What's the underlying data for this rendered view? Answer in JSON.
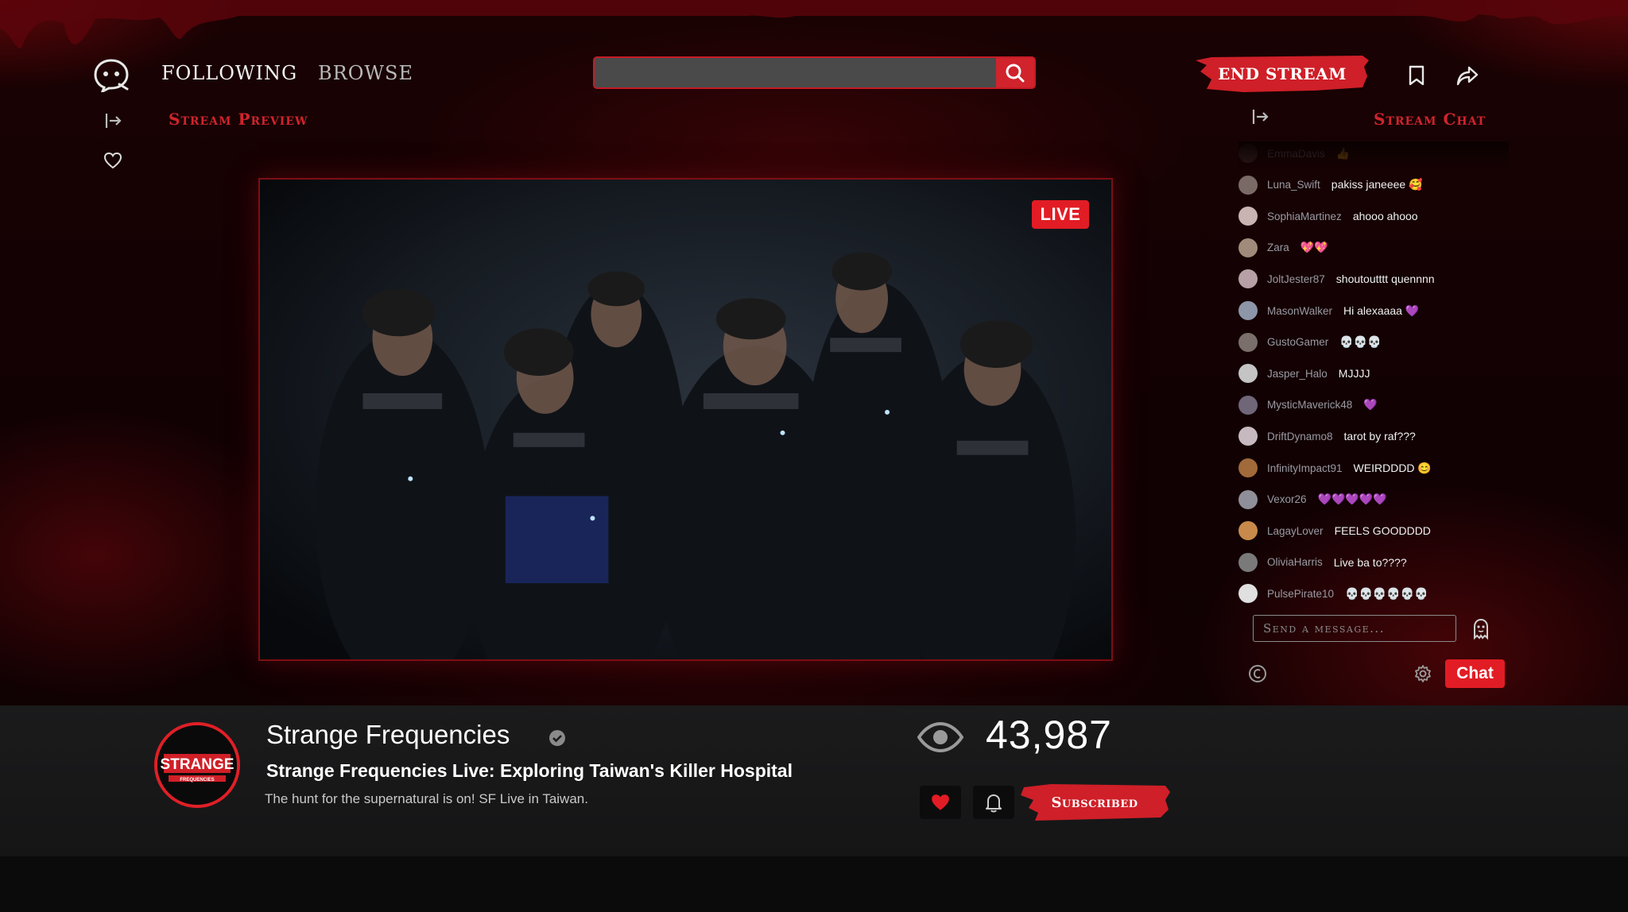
{
  "nav": {
    "following": "FOLLOWING",
    "browse": "BROWSE",
    "search_placeholder": "",
    "end_stream": "END STREAM"
  },
  "preview": {
    "title": "Stream Preview",
    "live_badge": "LIVE"
  },
  "chat": {
    "title": "Stream Chat",
    "messages": [
      {
        "user": "EmmaDavis",
        "text": "👍",
        "avatar_color": "#5a4a44"
      },
      {
        "user": "Luna_Swift",
        "text": "pakiss janeeee 🥰",
        "avatar_color": "#7a6a66"
      },
      {
        "user": "SophiaMartinez",
        "text": "ahooo ahooo",
        "avatar_color": "#c9b4b2"
      },
      {
        "user": "Zara",
        "text": "💖💖",
        "avatar_color": "#a08a7a"
      },
      {
        "user": "JoltJester87",
        "text": "shoutoutttt quennnn",
        "avatar_color": "#b7a0a6"
      },
      {
        "user": "MasonWalker",
        "text": "Hi alexaaaa 💜",
        "avatar_color": "#8d95a8"
      },
      {
        "user": "GustoGamer",
        "text": "💀💀💀",
        "avatar_color": "#7a6f6a"
      },
      {
        "user": "Jasper_Halo",
        "text": "MJJJJ",
        "avatar_color": "#c4c4c4"
      },
      {
        "user": "MysticMaverick48",
        "text": "💜",
        "avatar_color": "#6f6678"
      },
      {
        "user": "DriftDynamo8",
        "text": "tarot by raf???",
        "avatar_color": "#c7b9c0"
      },
      {
        "user": "InfinityImpact91",
        "text": "WEIRDDDD 😊",
        "avatar_color": "#a06a3a"
      },
      {
        "user": "Vexor26",
        "text": "💜💜💜💜💜",
        "avatar_color": "#8f8f9a"
      },
      {
        "user": "LagayLover",
        "text": "FEELS GOODDDD",
        "avatar_color": "#c88a4a"
      },
      {
        "user": "OliviaHarris",
        "text": "Live ba to????",
        "avatar_color": "#7a7a7a"
      },
      {
        "user": "PulsePirate10",
        "text": "💀💀💀💀💀💀",
        "avatar_color": "#e0e0e0"
      }
    ],
    "input_placeholder": "Send a message...",
    "send_label": "Chat"
  },
  "channel": {
    "name": "Strange Frequencies",
    "logo_text_main": "STRANGE",
    "logo_text_sub": "FREQUENCIES",
    "stream_title": "Strange Frequencies Live: Exploring Taiwan's Killer Hospital",
    "description": "The hunt for the supernatural is on! SF Live in Taiwan.",
    "viewers": "43,987",
    "subscribed_label": "Subscribed"
  },
  "colors": {
    "accent": "#e21c24",
    "dark_red": "#7d0e13",
    "background": "#120103"
  },
  "icons": [
    "ghost-logo-icon",
    "search-icon",
    "bookmark-icon",
    "share-icon",
    "collapse-icon",
    "heart-icon",
    "ghost-emote-icon",
    "coin-icon",
    "gear-icon",
    "verified-icon",
    "eye-icon",
    "bell-icon"
  ]
}
